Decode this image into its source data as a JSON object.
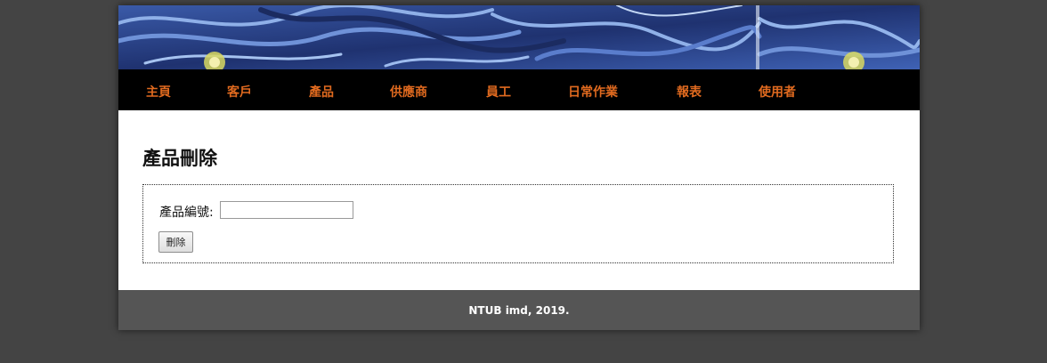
{
  "nav": {
    "items": [
      {
        "label": "主頁"
      },
      {
        "label": "客戶"
      },
      {
        "label": "產品"
      },
      {
        "label": "供應商"
      },
      {
        "label": "員工"
      },
      {
        "label": "日常作業"
      },
      {
        "label": "報表"
      },
      {
        "label": "使用者"
      }
    ]
  },
  "main": {
    "title": "產品刪除",
    "form": {
      "product_id_label": "產品編號:",
      "product_id_value": "",
      "delete_button": "刪除"
    }
  },
  "footer": {
    "text": "NTUB imd, 2019."
  },
  "colors": {
    "nav_background": "#000000",
    "nav_link": "#e06a1f",
    "footer_background": "#555555",
    "page_background": "#444444"
  }
}
